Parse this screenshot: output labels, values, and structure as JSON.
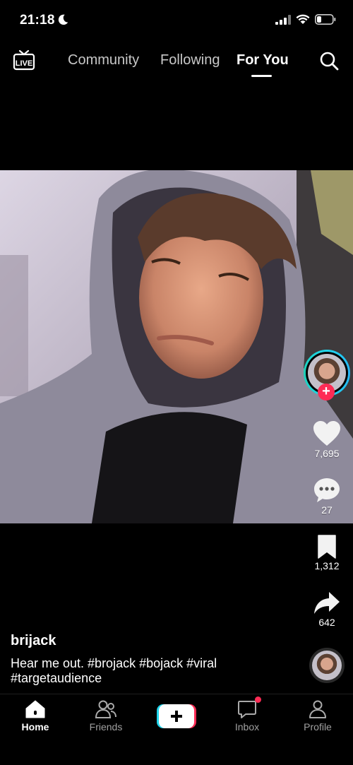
{
  "status": {
    "time": "21:18"
  },
  "nav": {
    "live_label": "LIVE",
    "tabs": [
      "Community",
      "Following",
      "For You"
    ],
    "active_tab": "For You"
  },
  "actions": {
    "likes": "7,695",
    "comments": "27",
    "saves": "1,312",
    "shares": "642"
  },
  "post": {
    "username": "brijack",
    "description": "Hear me out. #brojack #bojack #viral #targetaudience"
  },
  "bottom_nav": {
    "home": "Home",
    "friends": "Friends",
    "inbox": "Inbox",
    "profile": "Profile"
  },
  "colors": {
    "accent_red": "#fe2c55",
    "accent_cyan": "#20d5ec",
    "background": "#000000"
  },
  "icons": [
    "moon-icon",
    "signal-icon",
    "wifi-icon",
    "battery-icon",
    "live-icon",
    "search-icon",
    "heart-icon",
    "comment-icon",
    "bookmark-icon",
    "share-icon",
    "home-icon",
    "friends-icon",
    "create-icon",
    "inbox-icon",
    "profile-icon"
  ]
}
